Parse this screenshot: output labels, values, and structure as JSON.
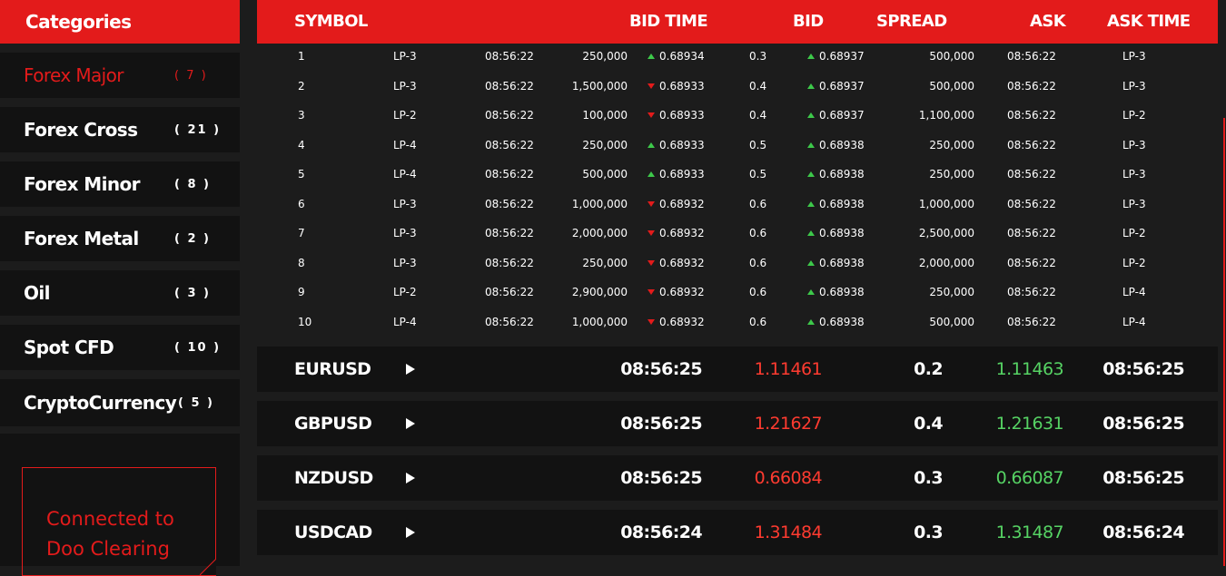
{
  "sidebar": {
    "title": "Categories",
    "items": [
      {
        "label": "Forex Major",
        "count": "( 7 )",
        "active": true
      },
      {
        "label": "Forex Cross",
        "count": "( 21 )"
      },
      {
        "label": "Forex Minor",
        "count": "( 8 )"
      },
      {
        "label": "Forex Metal",
        "count": "( 2 )"
      },
      {
        "label": "Oil",
        "count": "( 3 )"
      },
      {
        "label": "Spot CFD",
        "count": "( 10 )"
      },
      {
        "label": "CryptoCurrency",
        "count": "( 5 )"
      }
    ],
    "connection": {
      "line1": "Connected to",
      "line2": "Doo Clearing"
    }
  },
  "header": {
    "symbol": "SYMBOL",
    "bid_time": "BID TIME",
    "bid": "BID",
    "spread": "SPREAD",
    "ask": "ASK",
    "ask_time": "ASK TIME"
  },
  "colors": {
    "accent": "#e31b1b",
    "up": "#56d364",
    "down": "#ff3b30"
  },
  "depth_rows": [
    {
      "n": "1",
      "lp": "LP-3",
      "t1": "08:56:22",
      "vol1": "250,000",
      "dir": "up",
      "bid": "0.68934",
      "spread": "0.3",
      "ask": "0.68937",
      "vol2": "500,000",
      "t2": "08:56:22",
      "lp2": "LP-3"
    },
    {
      "n": "2",
      "lp": "LP-3",
      "t1": "08:56:22",
      "vol1": "1,500,000",
      "dir": "down",
      "bid": "0.68933",
      "spread": "0.4",
      "ask": "0.68937",
      "vol2": "500,000",
      "t2": "08:56:22",
      "lp2": "LP-3"
    },
    {
      "n": "3",
      "lp": "LP-2",
      "t1": "08:56:22",
      "vol1": "100,000",
      "dir": "down",
      "bid": "0.68933",
      "spread": "0.4",
      "ask": "0.68937",
      "vol2": "1,100,000",
      "t2": "08:56:22",
      "lp2": "LP-2"
    },
    {
      "n": "4",
      "lp": "LP-4",
      "t1": "08:56:22",
      "vol1": "250,000",
      "dir": "up",
      "bid": "0.68933",
      "spread": "0.5",
      "ask": "0.68938",
      "vol2": "250,000",
      "t2": "08:56:22",
      "lp2": "LP-3"
    },
    {
      "n": "5",
      "lp": "LP-4",
      "t1": "08:56:22",
      "vol1": "500,000",
      "dir": "up",
      "bid": "0.68933",
      "spread": "0.5",
      "ask": "0.68938",
      "vol2": "250,000",
      "t2": "08:56:22",
      "lp2": "LP-3"
    },
    {
      "n": "6",
      "lp": "LP-3",
      "t1": "08:56:22",
      "vol1": "1,000,000",
      "dir": "down",
      "bid": "0.68932",
      "spread": "0.6",
      "ask": "0.68938",
      "vol2": "1,000,000",
      "t2": "08:56:22",
      "lp2": "LP-3"
    },
    {
      "n": "7",
      "lp": "LP-3",
      "t1": "08:56:22",
      "vol1": "2,000,000",
      "dir": "down",
      "bid": "0.68932",
      "spread": "0.6",
      "ask": "0.68938",
      "vol2": "2,500,000",
      "t2": "08:56:22",
      "lp2": "LP-2"
    },
    {
      "n": "8",
      "lp": "LP-3",
      "t1": "08:56:22",
      "vol1": "250,000",
      "dir": "down",
      "bid": "0.68932",
      "spread": "0.6",
      "ask": "0.68938",
      "vol2": "2,000,000",
      "t2": "08:56:22",
      "lp2": "LP-2"
    },
    {
      "n": "9",
      "lp": "LP-2",
      "t1": "08:56:22",
      "vol1": "2,900,000",
      "dir": "down",
      "bid": "0.68932",
      "spread": "0.6",
      "ask": "0.68938",
      "vol2": "250,000",
      "t2": "08:56:22",
      "lp2": "LP-4"
    },
    {
      "n": "10",
      "lp": "LP-4",
      "t1": "08:56:22",
      "vol1": "1,000,000",
      "dir": "down",
      "bid": "0.68932",
      "spread": "0.6",
      "ask": "0.68938",
      "vol2": "500,000",
      "t2": "08:56:22",
      "lp2": "LP-4"
    }
  ],
  "quotes": [
    {
      "symbol": "EURUSD",
      "bid_time": "08:56:25",
      "bid": "1.11461",
      "spread": "0.2",
      "ask": "1.11463",
      "ask_time": "08:56:25"
    },
    {
      "symbol": "GBPUSD",
      "bid_time": "08:56:25",
      "bid": "1.21627",
      "spread": "0.4",
      "ask": "1.21631",
      "ask_time": "08:56:25"
    },
    {
      "symbol": "NZDUSD",
      "bid_time": "08:56:25",
      "bid": "0.66084",
      "spread": "0.3",
      "ask": "0.66087",
      "ask_time": "08:56:25"
    },
    {
      "symbol": "USDCAD",
      "bid_time": "08:56:24",
      "bid": "1.31484",
      "spread": "0.3",
      "ask": "1.31487",
      "ask_time": "08:56:24"
    }
  ]
}
